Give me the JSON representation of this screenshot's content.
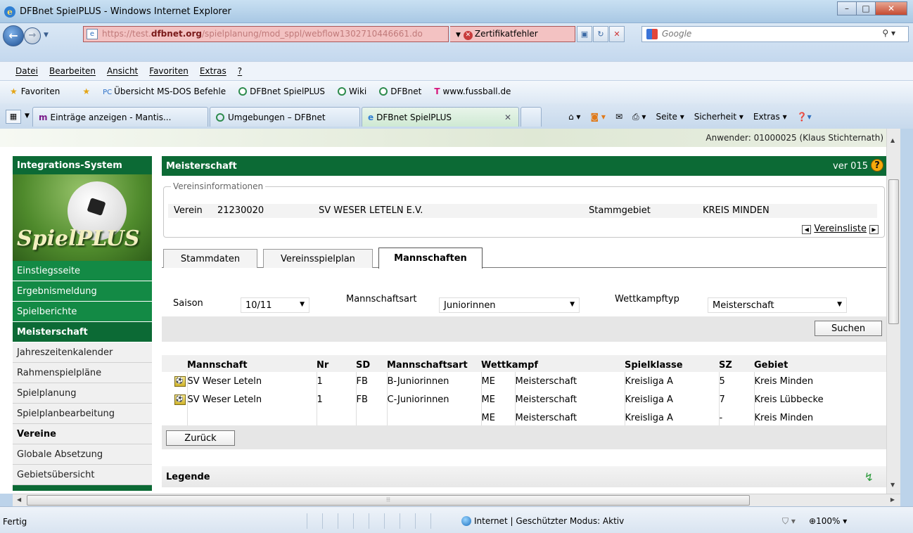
{
  "window": {
    "title": "DFBnet SpielPLUS - Windows Internet Explorer"
  },
  "address": {
    "url_prefix": "https://test.",
    "url_domain": "dfbnet.org",
    "url_path": "/spielplanung/mod_sppl/webflow1302710446661.do",
    "cert_error": "Zertifikatfehler",
    "search_placeholder": "Google"
  },
  "menu": [
    "Datei",
    "Bearbeiten",
    "Ansicht",
    "Favoriten",
    "Extras",
    "?"
  ],
  "favorites": {
    "label": "Favoriten",
    "links": [
      "Übersicht MS-DOS Befehle",
      "DFBnet SpielPLUS",
      "Wiki",
      "DFBnet",
      "www.fussball.de"
    ]
  },
  "browser_tabs": [
    {
      "label": "Einträge anzeigen - Mantis..."
    },
    {
      "label": "Umgebungen – DFBnet"
    },
    {
      "label": "DFBnet SpielPLUS"
    }
  ],
  "commands": {
    "seite": "Seite ▾",
    "sicherheit": "Sicherheit ▾",
    "extras": "Extras ▾"
  },
  "user": "Anwender: 01000025 (Klaus Stichternath)",
  "sidebar": {
    "header": "Integrations-System",
    "logo": "SpielPLUS",
    "items": [
      {
        "label": "Einstiegsseite",
        "kind": "green"
      },
      {
        "label": "Ergebnismeldung",
        "kind": "green"
      },
      {
        "label": "Spielberichte",
        "kind": "green"
      },
      {
        "label": "Meisterschaft",
        "kind": "section"
      },
      {
        "label": "Jahreszeitenkalender",
        "kind": "plain"
      },
      {
        "label": "Rahmenspielpläne",
        "kind": "plain"
      },
      {
        "label": "Spielplanung",
        "kind": "plain"
      },
      {
        "label": "Spielplanbearbeitung",
        "kind": "plain"
      },
      {
        "label": "Vereine",
        "kind": "plain-bold"
      },
      {
        "label": "Globale Absetzung",
        "kind": "plain"
      },
      {
        "label": "Gebietsübersicht",
        "kind": "plain"
      }
    ]
  },
  "main": {
    "title": "Meisterschaft",
    "version": "ver 015",
    "vereinsinfo": {
      "legend": "Vereinsinformationen",
      "verein_label": "Verein",
      "verein_nr": "21230020",
      "verein_name": "SV WESER LETELN E.V.",
      "stammgebiet_label": "Stammgebiet",
      "stammgebiet": "KREIS MINDEN",
      "vereinsliste": "Vereinsliste"
    },
    "tabs": [
      "Stammdaten",
      "Vereinsspielplan",
      "Mannschaften"
    ],
    "filters": {
      "saison_label": "Saison",
      "saison": "10/11",
      "mannschaftsart_label": "Mannschaftsart",
      "mannschaftsart": "Juniorinnen",
      "wettkampftyp_label": "Wettkampftyp",
      "wettkampftyp": "Meisterschaft",
      "search_button": "Suchen"
    },
    "table": {
      "headers": [
        "Mannschaft",
        "Nr",
        "SD",
        "Mannschaftsart",
        "Wettkampf",
        "Spielklasse",
        "SZ",
        "Gebiet"
      ],
      "rows": [
        [
          "SV Weser Leteln",
          "1",
          "FB",
          "B-Juniorinnen",
          "ME",
          "Meisterschaft",
          "Kreisliga A",
          "5",
          "Kreis Minden"
        ],
        [
          "SV Weser Leteln",
          "1",
          "FB",
          "C-Juniorinnen",
          "ME",
          "Meisterschaft",
          "Kreisliga A",
          "7",
          "Kreis Lübbecke"
        ],
        [
          "",
          "",
          "",
          "",
          "ME",
          "Meisterschaft",
          "Kreisliga A",
          "-",
          "Kreis Minden"
        ]
      ],
      "back_button": "Zurück"
    },
    "legend_title": "Legende"
  },
  "status": {
    "text": "Fertig",
    "zone": "Internet | Geschützter Modus: Aktiv",
    "zoom": "100%"
  },
  "colors": {
    "dfb_green": "#0c6a35",
    "sidebar_green": "#138a45",
    "cert_error_bg": "#f3c2c2"
  }
}
